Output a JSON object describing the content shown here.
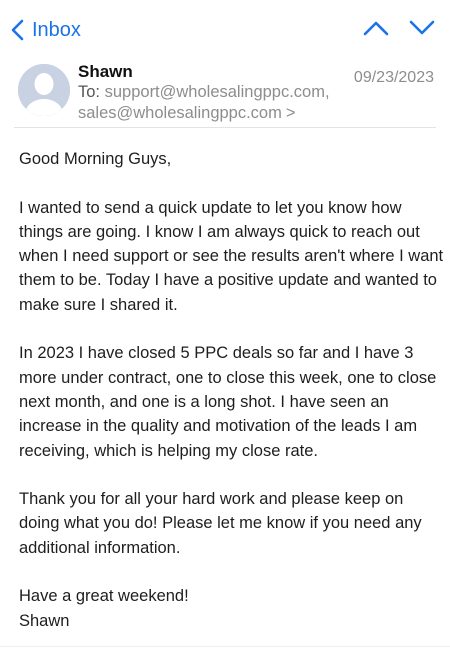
{
  "nav": {
    "back_label": "Inbox",
    "accent_color": "#1a73e8",
    "icons": [
      "chevron-left-icon",
      "chevron-up-icon",
      "chevron-down-icon"
    ]
  },
  "message": {
    "sender": "Shawn",
    "date": "09/23/2023",
    "to_label": "To:",
    "recipients": [
      "support@wholesalingppc.com,",
      "sales@wholesalingppc.com"
    ],
    "recipients_chevron": ">",
    "avatar_icon": "person-silhouette-icon",
    "greeting": "Good Morning Guys,",
    "paragraphs": [
      "I wanted to send a quick update to let you know how things are going. I know I am always quick to reach out when I need support or see the results aren't where I want them to be. Today I have a positive update and wanted to make sure I shared it.",
      "In 2023 I have closed 5 PPC deals so far and I have 3 more under contract, one to close this week, one to close next month, and one is a long shot. I have seen an increase in the quality and motivation of the leads I am receiving, which is helping my close rate.",
      "Thank you for all your hard work and please keep on doing what you do! Please let me know if you need any additional information."
    ],
    "closing": "Have a great weekend!",
    "signature": "Shawn"
  }
}
